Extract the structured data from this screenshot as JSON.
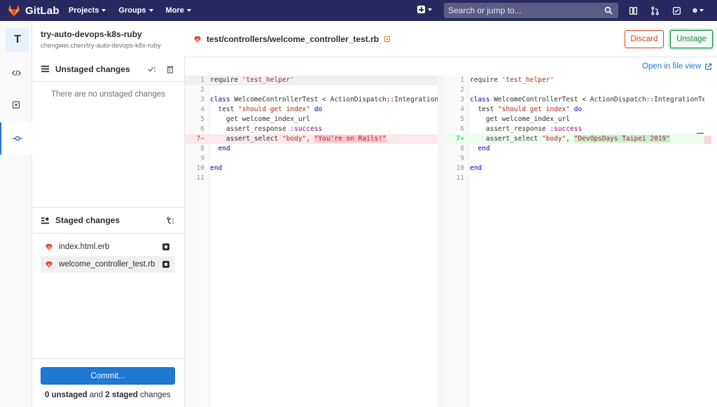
{
  "topbar": {
    "brand": "GitLab",
    "nav": [
      "Projects",
      "Groups",
      "More"
    ],
    "search_placeholder": "Search or jump to..."
  },
  "project": {
    "initial": "T",
    "name": "try-auto-devops-k8s-ruby",
    "path": "chengwei.chen/try-auto-devops-k8s-ruby"
  },
  "unstaged": {
    "title": "Unstaged changes",
    "empty_message": "There are no unstaged changes"
  },
  "staged": {
    "title": "Staged changes",
    "files": [
      "index.html.erb",
      "welcome_controller_test.rb"
    ]
  },
  "commit": {
    "button": "Commit...",
    "summary_unstaged": "0 unstaged",
    "summary_and": " and ",
    "summary_staged": "2 staged",
    "summary_suffix": " changes"
  },
  "file": {
    "path": "test/controllers/welcome_controller_test.rb",
    "discard_label": "Discard",
    "unstage_label": "Unstage",
    "open_link": "Open in file view"
  },
  "diff": {
    "left_marker": "7−",
    "right_marker": "7+",
    "removed_string": "\"You're on Rails!\"",
    "added_string": "\"DevOpsDays Taipei 2019\""
  }
}
